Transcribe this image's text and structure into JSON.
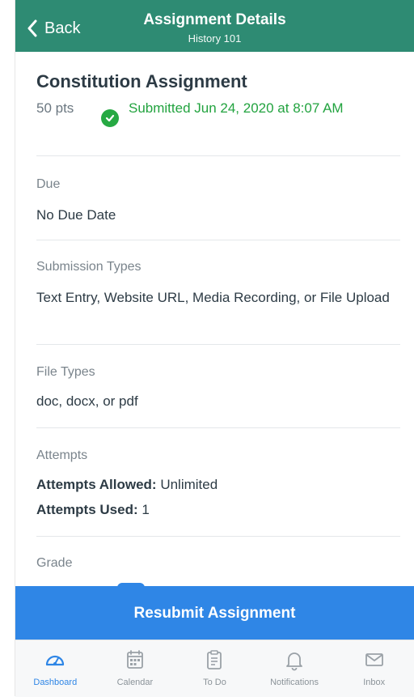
{
  "header": {
    "back_label": "Back",
    "title": "Assignment Details",
    "subtitle": "History 101"
  },
  "assignment": {
    "title": "Constitution Assignment",
    "points": "50 pts",
    "status": "Submitted Jun 24, 2020 at 8:07 AM"
  },
  "sections": {
    "due": {
      "label": "Due",
      "value": "No Due Date"
    },
    "submission_types": {
      "label": "Submission Types",
      "value": "Text Entry, Website URL, Media Recording, or File Upload"
    },
    "file_types": {
      "label": "File Types",
      "value": "doc, docx, or pdf"
    },
    "attempts": {
      "label": "Attempts",
      "allowed_label": "Attempts Allowed:",
      "allowed_value": "Unlimited",
      "used_label": "Attempts Used:",
      "used_value": "1"
    },
    "grade": {
      "label": "Grade"
    }
  },
  "actions": {
    "resubmit_label": "Resubmit Assignment"
  },
  "tabs": [
    {
      "label": "Dashboard",
      "icon": "dashboard-icon",
      "active": true
    },
    {
      "label": "Calendar",
      "icon": "calendar-icon",
      "active": false
    },
    {
      "label": "To Do",
      "icon": "todo-icon",
      "active": false
    },
    {
      "label": "Notifications",
      "icon": "notifications-icon",
      "active": false
    },
    {
      "label": "Inbox",
      "icon": "inbox-icon",
      "active": false
    }
  ],
  "colors": {
    "header_bg": "#2e8b73",
    "accent": "#2f86e6",
    "success": "#26a943"
  }
}
